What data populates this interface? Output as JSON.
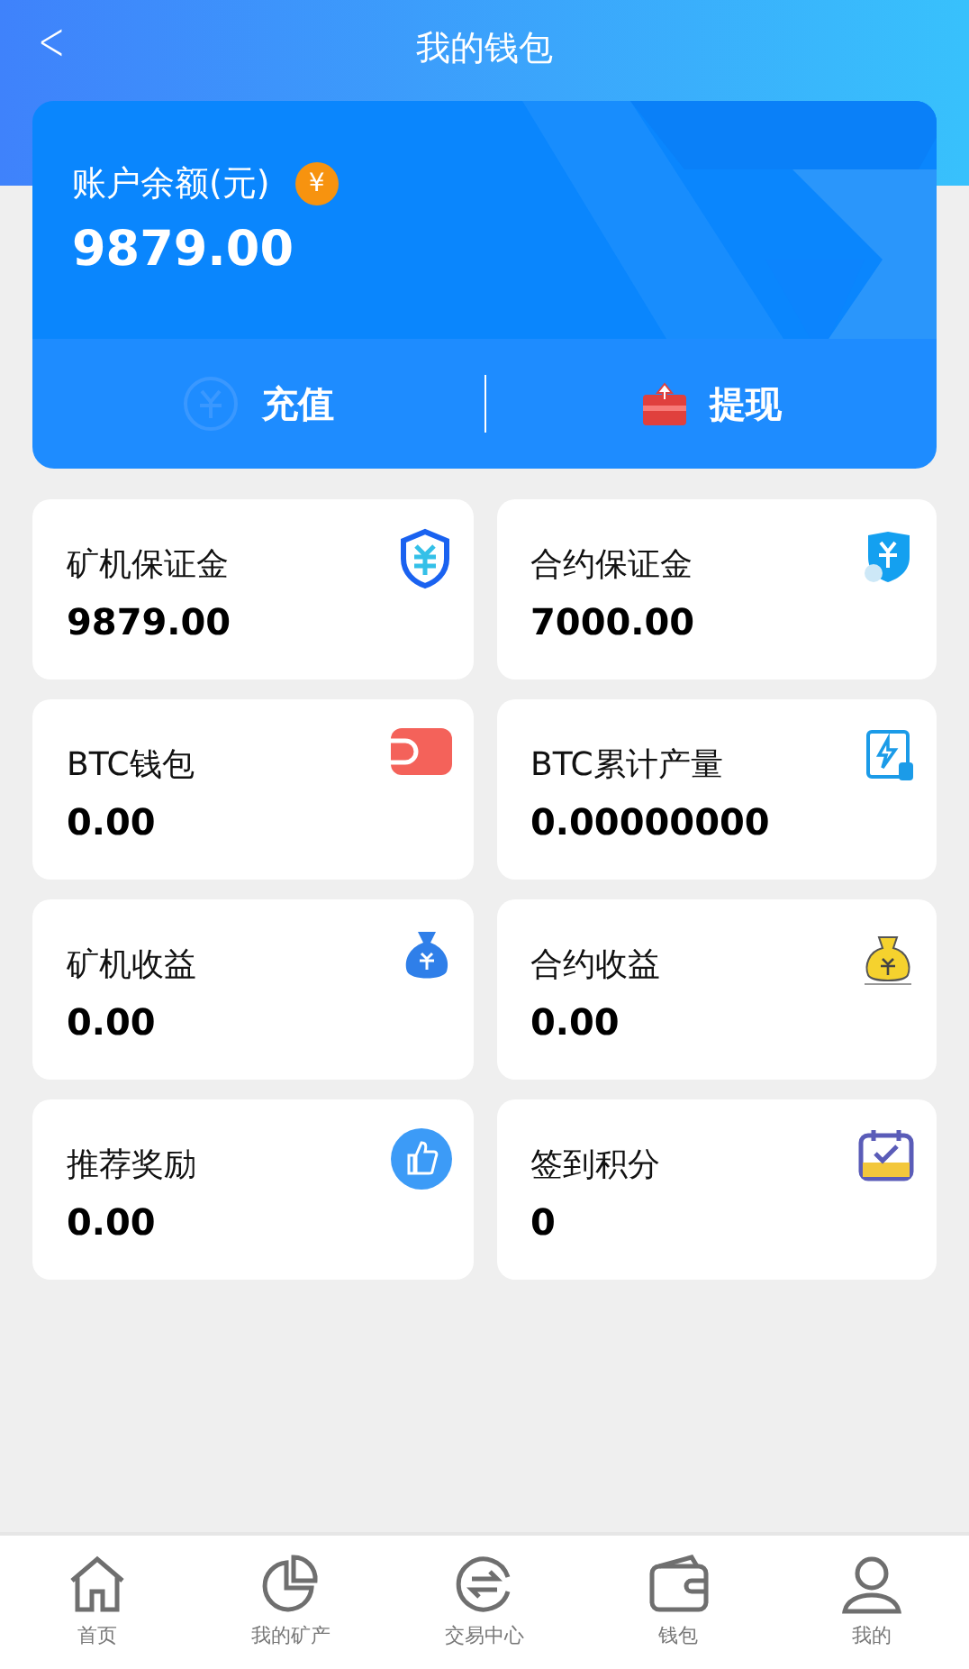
{
  "header": {
    "back": "<",
    "title": "我的钱包"
  },
  "balance": {
    "label": "账户余额(元)",
    "currency": "¥",
    "amount": "9879.00"
  },
  "actions": [
    {
      "kind": "recharge",
      "label": "充值"
    },
    {
      "kind": "withdraw",
      "label": "提现"
    }
  ],
  "stats": [
    {
      "label": "矿机保证金",
      "value": "9879.00",
      "kind": "shield"
    },
    {
      "label": "合约保证金",
      "value": "7000.00",
      "kind": "shield-cert"
    },
    {
      "label": "BTC钱包",
      "value": "0.00",
      "kind": "wallet"
    },
    {
      "label": "BTC累计产量",
      "value": "0.00000000",
      "kind": "bolt"
    },
    {
      "label": "矿机收益",
      "value": "0.00",
      "kind": "bag-blue"
    },
    {
      "label": "合约收益",
      "value": "0.00",
      "kind": "bag-gold"
    },
    {
      "label": "推荐奖励",
      "value": "0.00",
      "kind": "thumb"
    },
    {
      "label": "签到积分",
      "value": "0",
      "kind": "calendar"
    }
  ],
  "tab_bar": [
    {
      "label": "首页",
      "kind": "home"
    },
    {
      "label": "我的矿产",
      "kind": "pie"
    },
    {
      "label": "交易中心",
      "kind": "exchange"
    },
    {
      "label": "钱包",
      "kind": "wallet"
    },
    {
      "label": "我的",
      "kind": "user"
    }
  ]
}
